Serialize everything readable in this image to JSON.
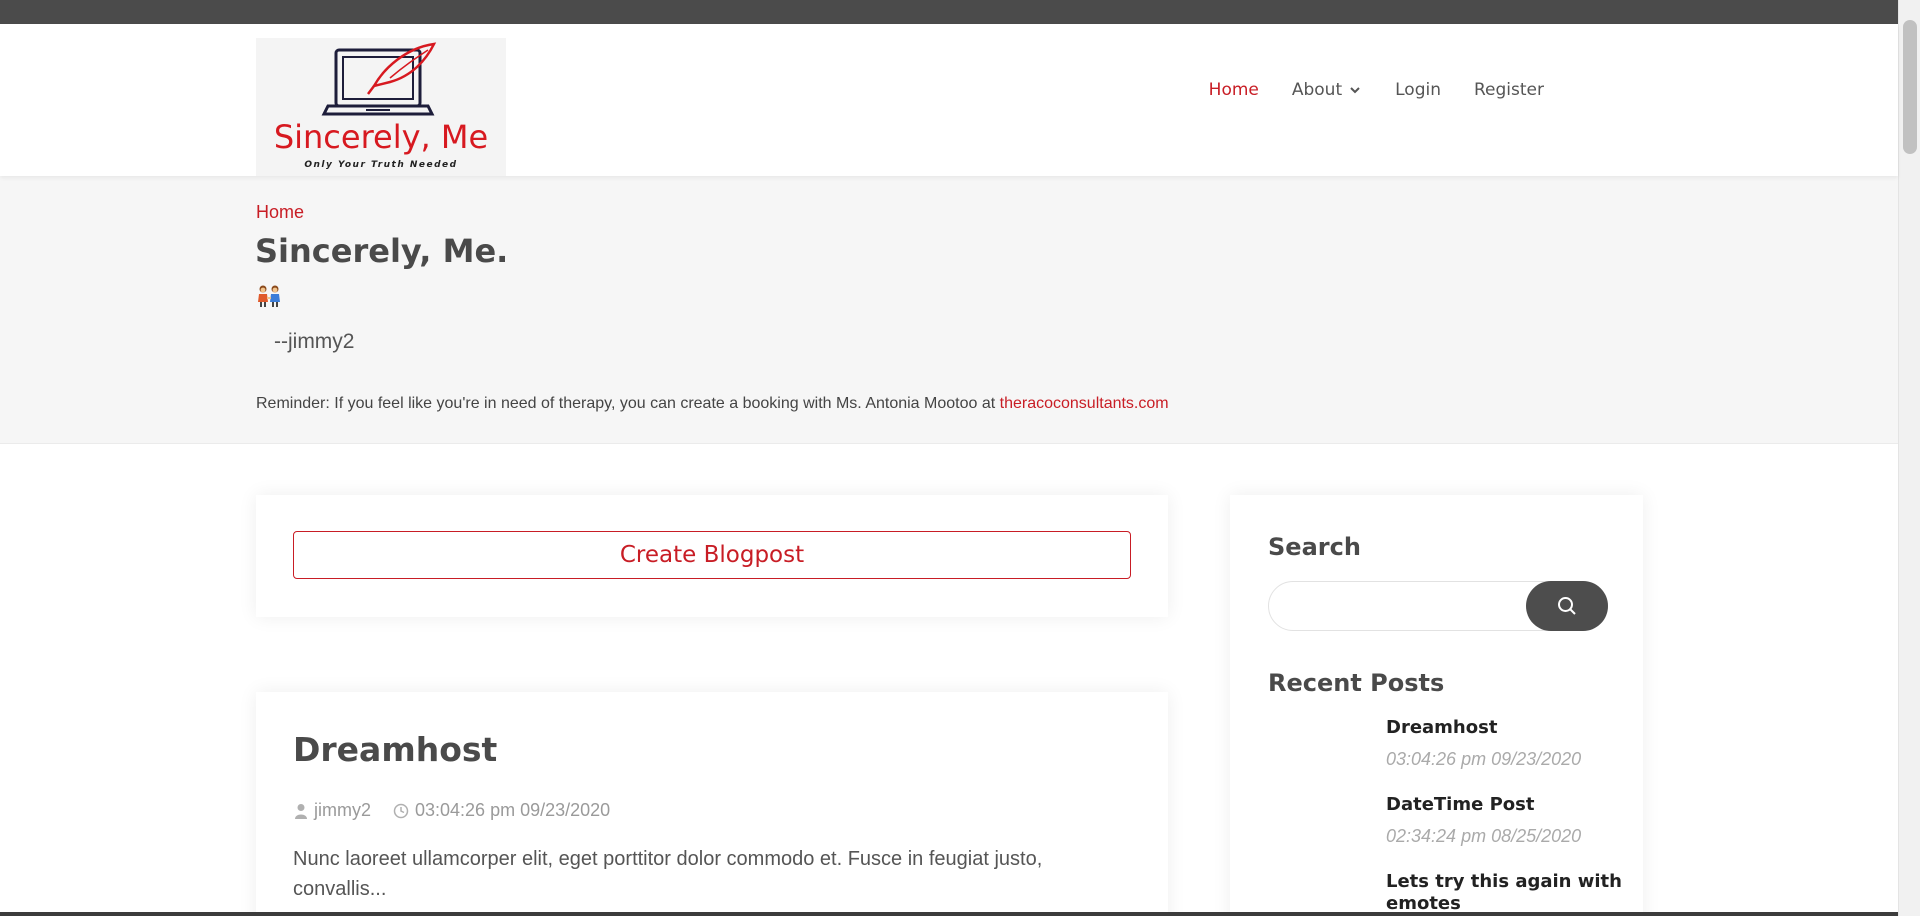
{
  "header": {
    "logo": {
      "brand": "Sincerely, Me",
      "tagline": "Only Your Truth Needed"
    },
    "nav": [
      {
        "label": "Home",
        "active": true
      },
      {
        "label": "About",
        "has_dropdown": true
      },
      {
        "label": "Login"
      },
      {
        "label": "Register"
      }
    ]
  },
  "hero": {
    "breadcrumb": "Home",
    "title": "Sincerely, Me.",
    "emoji_icon": "two-women-holding-hands-icon",
    "signature": "--jimmy2",
    "reminder_text": "Reminder: If you feel like you're in need of therapy, you can create a booking with Ms. Antonia Mootoo at ",
    "reminder_link": "theracoconsultants.com"
  },
  "main": {
    "create_button_label": "Create Blogpost",
    "posts": [
      {
        "title": "Dreamhost",
        "author": "jimmy2",
        "timestamp": "03:04:26 pm 09/23/2020",
        "excerpt": "Nunc laoreet ullamcorper elit, eget porttitor dolor commodo et. Fusce in feugiat justo, convallis..."
      }
    ]
  },
  "sidebar": {
    "search_heading": "Search",
    "search_placeholder": "",
    "recent_heading": "Recent Posts",
    "recent_posts": [
      {
        "title": "Dreamhost",
        "date": "03:04:26 pm 09/23/2020"
      },
      {
        "title": "DateTime Post",
        "date": "02:34:24 pm 08/25/2020"
      },
      {
        "title": "Lets try this again with emotes",
        "date": ""
      }
    ]
  },
  "colors": {
    "accent": "#c81d25",
    "text": "#4a4a4a",
    "topbar": "#4b4b4b",
    "hero_bg": "#f6f6f6"
  }
}
